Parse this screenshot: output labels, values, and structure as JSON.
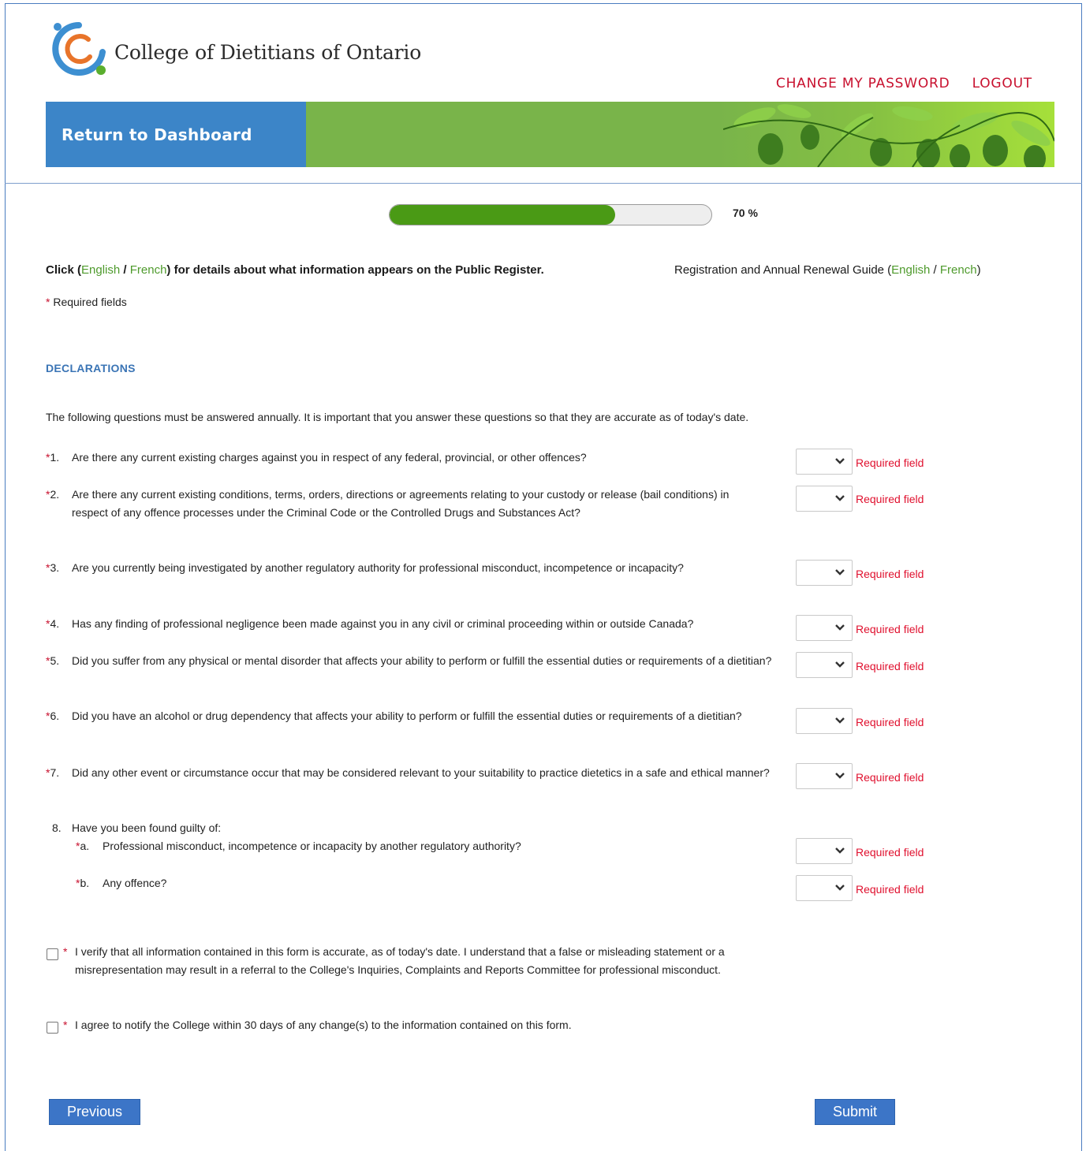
{
  "header": {
    "org_name": "College of Dietitians of Ontario",
    "change_password": "CHANGE MY PASSWORD",
    "logout": "LOGOUT",
    "return_dashboard": "Return to Dashboard"
  },
  "progress": {
    "percent": 70,
    "label": "70 %"
  },
  "info": {
    "click_prefix": "Click (",
    "english": "English",
    "slash": " / ",
    "french": "French",
    "click_suffix": ") for details about what information appears on the Public Register.",
    "guide_prefix": "Registration and Annual Renewal Guide (",
    "guide_english": "English",
    "guide_slash": " / ",
    "guide_french": "French",
    "guide_suffix": ")",
    "required_star": "*",
    "required_note": " Required fields"
  },
  "section": {
    "title": "DECLARATIONS",
    "intro": "The following questions must be answered annually. It is important that you answer these questions so that they are accurate as of today's date."
  },
  "questions": [
    {
      "star": "*",
      "num": "1.",
      "text": "Are there any current existing charges against you in respect of any federal, provincial, or other offences?",
      "required_msg": "Required field"
    },
    {
      "star": "*",
      "num": "2.",
      "text": "Are there any current existing conditions, terms, orders, directions or agreements relating to your custody or release (bail conditions) in respect of any offence processes under the Criminal Code or the Controlled Drugs and Substances Act?",
      "required_msg": "Required field"
    },
    {
      "star": "*",
      "num": "3.",
      "text": "Are you currently being investigated by another regulatory authority for professional misconduct, incompetence or incapacity?",
      "required_msg": "Required field"
    },
    {
      "star": "*",
      "num": "4.",
      "text": "Has any finding of professional negligence been made against you in any civil or criminal proceeding within or outside Canada?",
      "required_msg": "Required field"
    },
    {
      "star": "*",
      "num": "5.",
      "text": "Did you suffer from any physical or mental disorder that affects your ability to perform or fulfill the essential duties or requirements of a dietitian?",
      "required_msg": "Required field"
    },
    {
      "star": "*",
      "num": "6.",
      "text": "Did you have an alcohol or drug dependency that affects your ability to perform or fulfill the essential duties or requirements of a dietitian?",
      "required_msg": "Required field"
    },
    {
      "star": "*",
      "num": "7.",
      "text": "Did any other event or circumstance occur that may be considered relevant to your suitability to practice dietetics in a safe and ethical manner?",
      "required_msg": "Required field"
    }
  ],
  "q8": {
    "num": "8.",
    "text": "Have you been found guilty of:",
    "subs": [
      {
        "star": "*",
        "num": "a.",
        "text": "Professional misconduct, incompetence or incapacity by another regulatory authority?",
        "required_msg": "Required field"
      },
      {
        "star": "*",
        "num": "b.",
        "text": "Any offence?",
        "required_msg": "Required field"
      }
    ]
  },
  "checkboxes": [
    {
      "star": "*",
      "text": "I verify that all information contained in this form is accurate, as of today's date. I understand that a false or misleading statement or a misrepresentation may result in a referral to the College's Inquiries, Complaints and Reports Committee for professional misconduct."
    },
    {
      "star": "*",
      "text": "I agree to notify the College within 30 days of any change(s) to the information contained on this form."
    }
  ],
  "buttons": {
    "previous": "Previous",
    "submit": "Submit"
  },
  "colors": {
    "accent_blue": "#3c85c8",
    "banner_green": "#79b44a",
    "progress_green": "#4a9a15",
    "link_red": "#c8102e",
    "required_red": "#e0102e",
    "link_green": "#4e9a2c"
  }
}
